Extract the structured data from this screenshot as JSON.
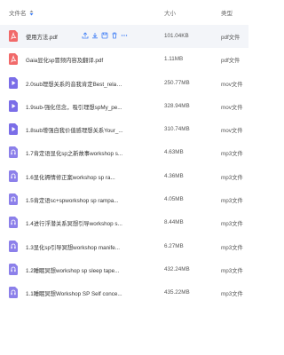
{
  "header": {
    "name_label": "文件名",
    "size_label": "大小",
    "type_label": "类型"
  },
  "files": [
    {
      "name": "使用方法.pdf",
      "size": "101.04KB",
      "type": "pdf文件",
      "icon": "pdf-icon"
    },
    {
      "name": "Gaia显化sp冒频内容及翻译.pdf",
      "size": "1.11MB",
      "type": "pdf文件",
      "icon": "pdf-icon"
    },
    {
      "name": "2.0sub理想关系的音我肯定Best_relati...",
      "size": "250.77MB",
      "type": "mov文件",
      "icon": "video-icon"
    },
    {
      "name": "1.9sub-强化信念，吸引理想spMy_pe...",
      "size": "328.94MB",
      "type": "mov文件",
      "icon": "video-icon"
    },
    {
      "name": "1.8sub增强自我价值感理想关系Your_...",
      "size": "310.74MB",
      "type": "mov文件",
      "icon": "video-icon"
    },
    {
      "name": "1.7肯定语显化sp之新故事workshop s...",
      "size": "4.63MB",
      "type": "mp3文件",
      "icon": "audio-icon"
    },
    {
      "name": "1.6显化褥情修正案workshop sp ra...",
      "size": "4.36MB",
      "type": "mp3文件",
      "icon": "audio-icon"
    },
    {
      "name": "1.5肯定语sc+spworkshop sp rampa...",
      "size": "4.05MB",
      "type": "mp3文件",
      "icon": "audio-icon"
    },
    {
      "name": "1.4进行浮潜关系冥想引导workshop s...",
      "size": "8.44MB",
      "type": "mp3文件",
      "icon": "audio-icon"
    },
    {
      "name": "1.3显化sp引导冥想workshop manife...",
      "size": "6.27MB",
      "type": "mp3文件",
      "icon": "audio-icon"
    },
    {
      "name": "1.2睡眠冥想workshop sp sleep tape...",
      "size": "432.24MB",
      "type": "mp3文件",
      "icon": "audio-icon"
    },
    {
      "name": "1.1睡眠冥想Workshop SP Self conce...",
      "size": "435.22MB",
      "type": "mp3文件",
      "icon": "audio-icon"
    }
  ],
  "colors": {
    "pdf": "#f16a6a",
    "video": "#7b6ee8",
    "audio": "#8c80ea",
    "action": "#3f7ef5"
  }
}
